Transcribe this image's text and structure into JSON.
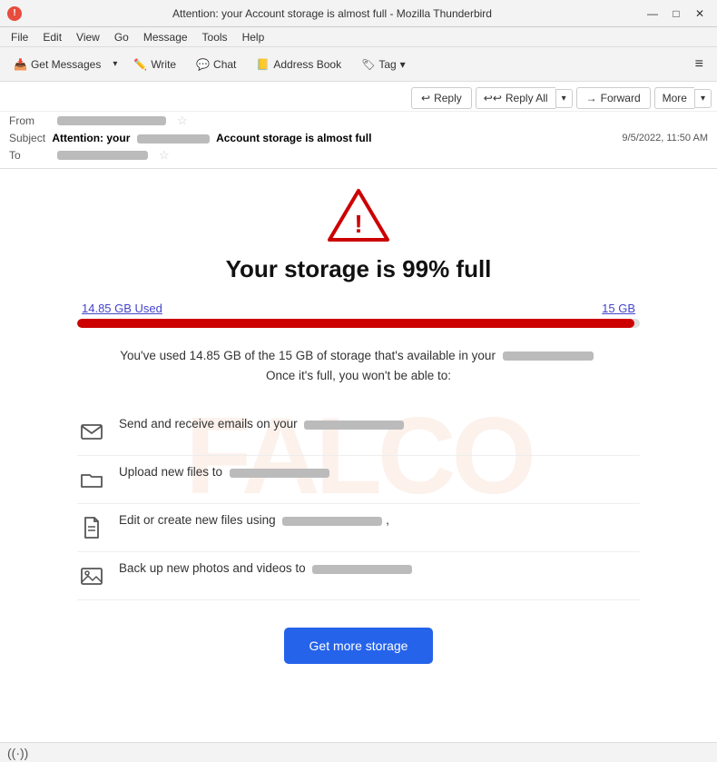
{
  "window": {
    "title": "Attention: your  Account storage is almost full - Mozilla Thunderbird",
    "icon": "!"
  },
  "title_controls": {
    "minimize": "—",
    "maximize": "□",
    "close": "✕"
  },
  "menu": {
    "items": [
      "File",
      "Edit",
      "View",
      "Go",
      "Message",
      "Tools",
      "Help"
    ]
  },
  "toolbar": {
    "get_messages_label": "Get Messages",
    "write_label": "Write",
    "chat_label": "Chat",
    "address_book_label": "Address Book",
    "tag_label": "Tag",
    "hamburger": "≡"
  },
  "email_actions": {
    "reply_label": "Reply",
    "reply_all_label": "Reply All",
    "forward_label": "Forward",
    "more_label": "More"
  },
  "email_header": {
    "from_label": "From",
    "subject_label": "Subject",
    "to_label": "To",
    "subject_prefix": "Attention: your",
    "subject_main": "Account storage is almost full",
    "date": "9/5/2022, 11:50 AM"
  },
  "email_body": {
    "storage_title": "Your storage is 99% full",
    "used_label": "14.85 GB Used",
    "total_label": "15 GB",
    "fill_percent": 99,
    "description_part1": "You've used 14.85 GB of the  15 GB of storage that's available in your",
    "description_part2": "Once it's full, you won't be able to:",
    "features": [
      {
        "icon": "mail",
        "text": "Send and receive emails on your",
        "blurred": true
      },
      {
        "icon": "folder",
        "text": "Upload new files to",
        "blurred": true
      },
      {
        "icon": "file",
        "text": "Edit or create new files using",
        "blurred": true,
        "suffix": ","
      },
      {
        "icon": "image",
        "text": "Back up new photos and videos to",
        "blurred": true
      }
    ],
    "cta_label": "Get more storage"
  },
  "status_bar": {
    "icon": "((·))"
  }
}
